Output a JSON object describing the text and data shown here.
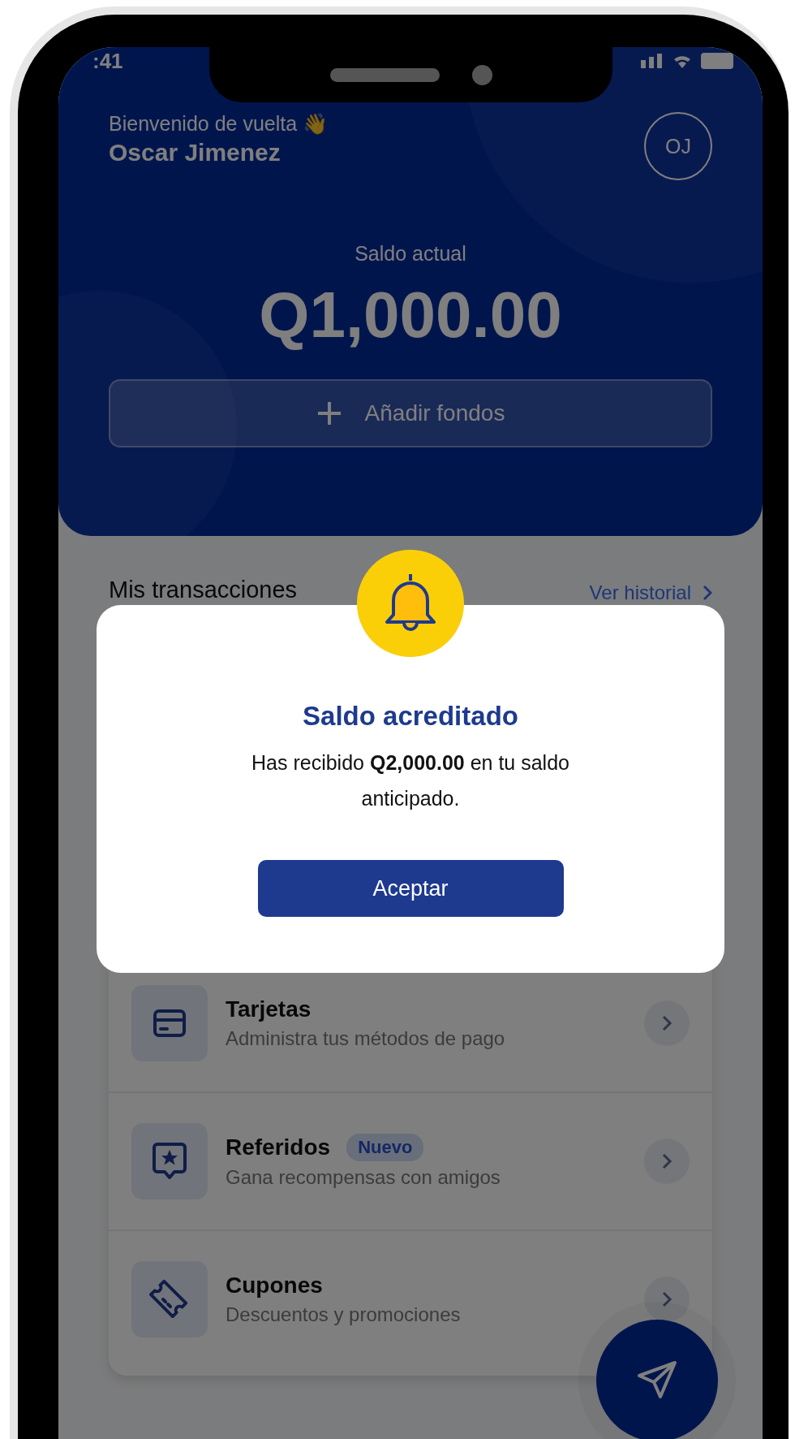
{
  "status_bar": {
    "time": ":41"
  },
  "header": {
    "greeting": "Bienvenido de vuelta 👋",
    "name": "Oscar Jimenez",
    "avatar_initials": "OJ",
    "balance_label": "Saldo actual",
    "balance": "Q1,000.00",
    "add_funds_button": "Añadir fondos"
  },
  "transactions": {
    "title": "Mis transacciones",
    "link": "Ver historial"
  },
  "menu": [
    {
      "kind": "card",
      "title": "Tarjetas",
      "subtitle": "Administra tus métodos de pago"
    },
    {
      "kind": "star",
      "title": "Referidos",
      "badge": "Nuevo",
      "subtitle": "Gana recompensas con amigos"
    },
    {
      "kind": "ticket",
      "title": "Cupones",
      "subtitle": "Descuentos y promociones"
    }
  ],
  "dialog": {
    "title": "Saldo acreditado",
    "message": "Has recibido **Q2,000.00** en tu saldo anticipado.",
    "button": "Aceptar"
  }
}
